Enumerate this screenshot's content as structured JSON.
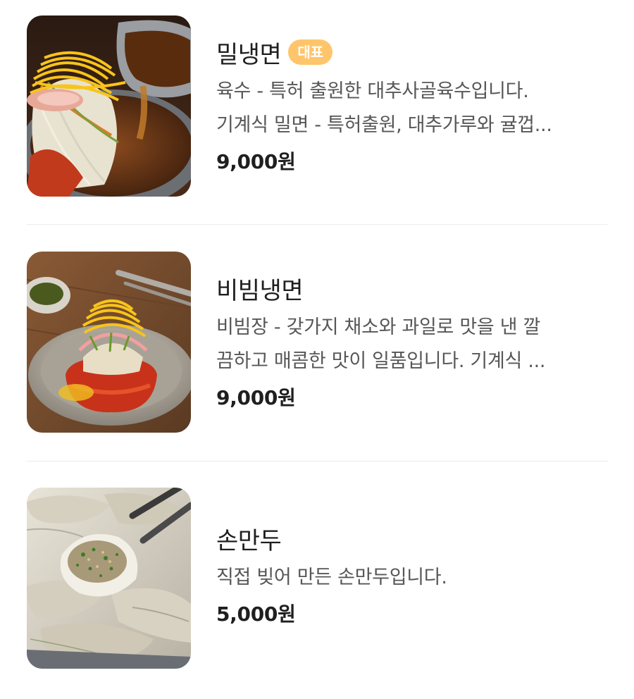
{
  "menu": {
    "items": [
      {
        "name": "밀냉면",
        "badge": "대표",
        "desc_lines": [
          "육수 - 특허 출원한 대추사골육수입니다.",
          "기계식 밀면 - 특허출원, 대추가루와 귤껍..."
        ],
        "price": "9,000원",
        "image": "mil-naengmyeon-photo"
      },
      {
        "name": "비빔냉면",
        "desc_lines": [
          "비빔장 - 갖가지 채소와 과일로 맛을 낸 깔",
          "끔하고 매콤한 맛이 일품입니다. 기계식 ..."
        ],
        "price": "9,000원",
        "image": "bibim-naengmyeon-photo"
      },
      {
        "name": "손만두",
        "desc_lines": [
          "직접 빚어 만든 손만두입니다."
        ],
        "price": "5,000원",
        "image": "son-mandu-photo"
      }
    ]
  },
  "colors": {
    "badge_bg": "#ffc56a",
    "text_primary": "#1f1f1f",
    "text_secondary": "#575757",
    "divider": "#ececec"
  }
}
